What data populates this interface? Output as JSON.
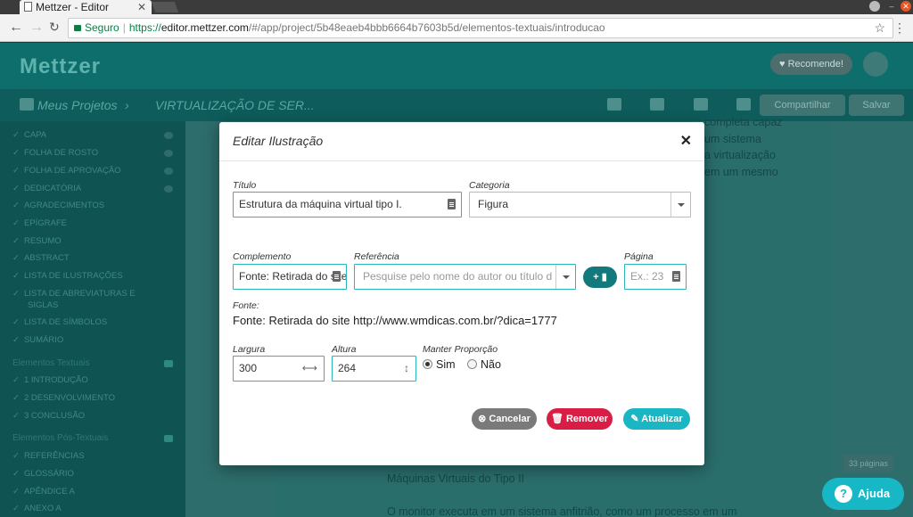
{
  "browser": {
    "tab_title": "Mettzer - Editor",
    "secure_label": "Seguro",
    "url_scheme": "https://",
    "url_host": "editor.mettzer.com",
    "url_path": "/#/app/project/5b48eaeb4bbb6664b7603b5d/elementos-textuais/introducao"
  },
  "app": {
    "logo": "Mettzer",
    "recommend_label": "Recomende!",
    "breadcrumb_projects": "Meus Projetos",
    "breadcrumb_doc": "VIRTUALIZAÇÃO DE SER...",
    "share_label": "Compartilhar",
    "save_label": "Salvar",
    "pages_label": "33 páginas",
    "help_label": "Ajuda"
  },
  "sidebar": {
    "items": [
      "CAPA",
      "FOLHA DE ROSTO",
      "FOLHA DE APROVAÇÃO",
      "DEDICATÓRIA",
      "AGRADECIMENTOS",
      "EPÍGRAFE",
      "RESUMO",
      "ABSTRACT",
      "LISTA DE ILUSTRAÇÕES",
      "LISTA DE ABREVIATURAS E",
      "SIGLAS",
      "LISTA DE SÍMBOLOS",
      "SUMÁRIO"
    ],
    "section_textual": "Elementos Textuais",
    "textual_items": [
      "1  INTRODUÇÃO",
      "2  DESENVOLVIMENTO",
      "3  CONCLUSÃO"
    ],
    "section_post": "Elementos Pós-Textuais",
    "post_items": [
      "REFERÊNCIAS",
      "GLOSSÁRIO",
      "APÊNDICE A",
      "ANEXO A"
    ]
  },
  "document": {
    "right_snippets": [
      "completa capaz",
      "um sistema",
      "a virtualização",
      "em um mesmo"
    ],
    "heading": "Máquinas Virtuais do Tipo II",
    "paragraph": "O monitor executa em um sistema anfitrião, como um processo em um"
  },
  "modal": {
    "title": "Editar Ilustração",
    "titulo_label": "Título",
    "titulo_value": "Estrutura da máquina virtual tipo I.",
    "categoria_label": "Categoria",
    "categoria_value": "Figura",
    "complemento_label": "Complemento",
    "complemento_value": "Fonte: Retirada do site",
    "referencia_label": "Referência",
    "referencia_placeholder": "Pesquise pelo nome do autor ou título d",
    "pagina_label": "Página",
    "pagina_placeholder": "Ex.: 23",
    "fonte_label": "Fonte:",
    "fonte_value": "Fonte: Retirada do site http://www.wmdicas.com.br/?dica=1777",
    "largura_label": "Largura",
    "largura_value": "300",
    "altura_label": "Altura",
    "altura_value": "264",
    "proporcao_label": "Manter Proporção",
    "sim_label": "Sim",
    "nao_label": "Não",
    "cancel_label": "Cancelar",
    "remove_label": "Remover",
    "update_label": "Atualizar"
  },
  "colors": {
    "accent": "#2bb6b9",
    "cancel": "#7a7a7a",
    "remove": "#d91e45",
    "update": "#1bb6c3"
  }
}
